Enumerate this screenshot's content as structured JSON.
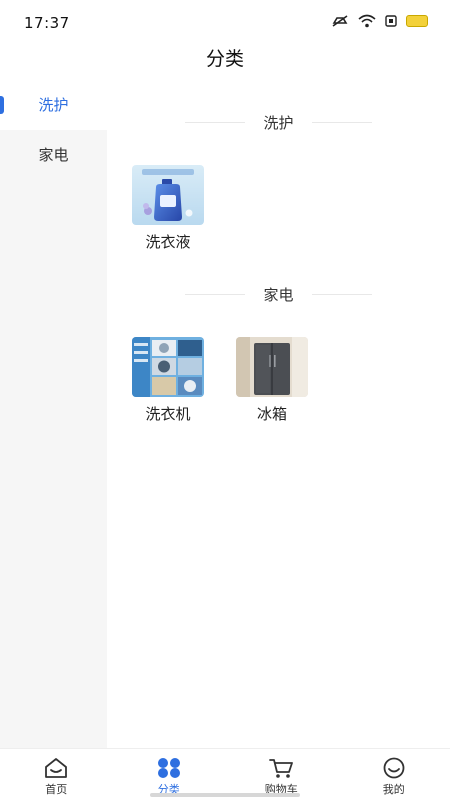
{
  "status_bar": {
    "time": "17:37"
  },
  "header": {
    "title": "分类"
  },
  "sidebar": {
    "items": [
      {
        "label": "洗护",
        "active": true
      },
      {
        "label": "家电",
        "active": false
      }
    ]
  },
  "sections": [
    {
      "title": "洗护",
      "products": [
        {
          "name": "洗衣液",
          "image": "laundry-detergent-bottle"
        }
      ]
    },
    {
      "title": "家电",
      "products": [
        {
          "name": "洗衣机",
          "image": "washing-machine-collage"
        },
        {
          "name": "冰箱",
          "image": "refrigerator"
        }
      ]
    }
  ],
  "tabbar": {
    "items": [
      {
        "label": "首页",
        "icon": "home-icon"
      },
      {
        "label": "分类",
        "icon": "category-icon",
        "active": true
      },
      {
        "label": "购物车",
        "icon": "cart-icon"
      },
      {
        "label": "我的",
        "icon": "profile-icon"
      }
    ]
  },
  "colors": {
    "accent": "#2e6fe0",
    "sidebar_bg": "#f6f6f6"
  }
}
